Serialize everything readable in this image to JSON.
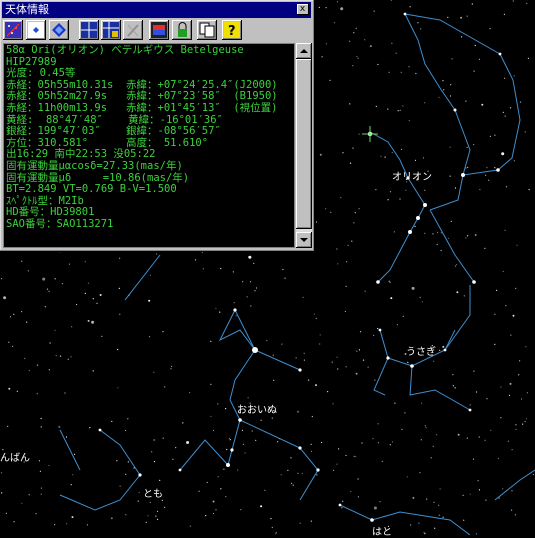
{
  "window": {
    "title": "天体情報",
    "close_glyph": "x",
    "toolbar_icons": [
      "star-map-icon",
      "small-star-icon",
      "blue-diamond-icon",
      "grid-icon",
      "grid-lock-icon",
      "pen-icon",
      "flag-icon",
      "lock-icon",
      "copy-icon",
      "help-icon"
    ],
    "help_glyph": "?"
  },
  "info_lines": [
    "58α Ori(オリオン) ベテルギウス Betelgeuse",
    "HIP27989",
    "光度: 0.45等",
    "赤経：05h55m10.31s  赤緯：+07°24′25.4″(J2000)",
    "赤経：05h52m27.9s   赤緯：+07°23′58″  (B1950)",
    "赤経：11h00m13.9s   赤緯：+01°45′13″  (視位置)",
    "黄経:  88°47′48″    黄緯：-16°01′36″",
    "銀経：199°47′03″    銀緯：-08°56′57″",
    "方位：310.581°      高度： 51.610°",
    "出16:29 南中22:53 没05:22",
    "固有運動量μαcosδ=27.33(mas/年)",
    "固有運動量μδ     =10.86(mas/年)",
    "BT=2.849 VT=0.769 B-V=1.500",
    "ｽﾍﾟｸﾄﾙ型：M2Ib",
    "HD番号：HD39801",
    "SAO番号：SAO113271"
  ],
  "sky": {
    "labels": {
      "orion": "オリオン",
      "lepus": "うさぎ",
      "canis_major": "おおいぬ",
      "monoceros_partial": "んばん",
      "puppis": "とも",
      "columba": "はと"
    },
    "colors": {
      "constellation_line": "#3e8fd0",
      "background": "#000000",
      "text_green": "#3cd23c"
    }
  }
}
